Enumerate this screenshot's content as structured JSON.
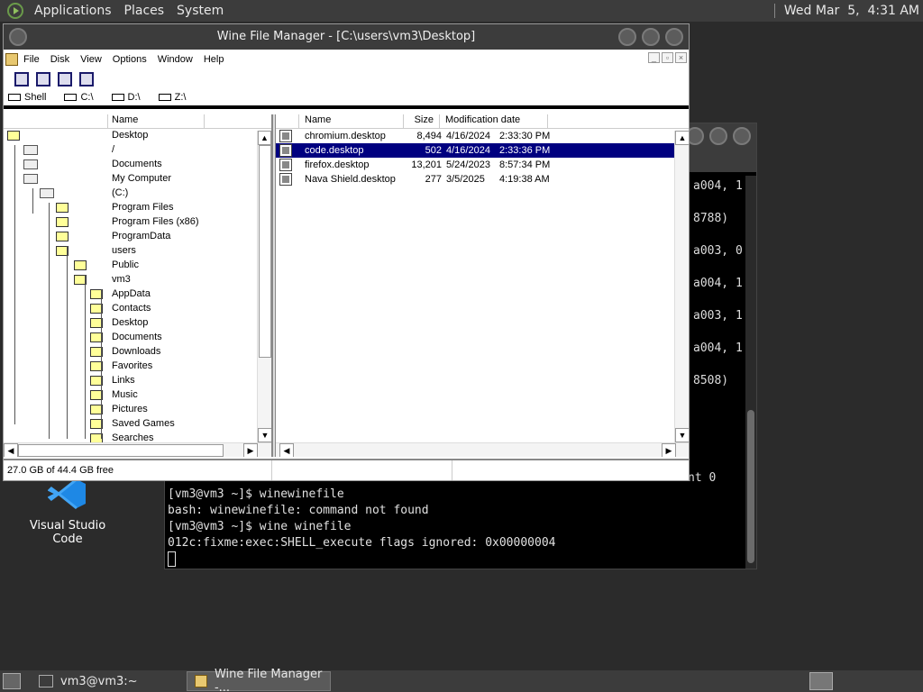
{
  "top_panel": {
    "menus": [
      "Applications",
      "Places",
      "System"
    ],
    "clock": "Wed Mar  5,  4:31 AM"
  },
  "desktop": {
    "vscode_label": "Visual Studio Code"
  },
  "terminal": {
    "right_fragments": [
      "a004, 1",
      "8788)",
      "a003, 0",
      "a004, 1",
      "a003, 1",
      "a004, 1",
      "8508)"
    ],
    "partial_line": "nt 0",
    "lines": [
      "[vm3@vm3 ~]$ winewinefile",
      "bash: winewinefile: command not found",
      "[vm3@vm3 ~]$ wine winefile",
      "012c:fixme:exec:SHELL_execute flags ignored: 0x00000004"
    ]
  },
  "wine": {
    "title": "Wine File Manager - [C:\\users\\vm3\\Desktop]",
    "menu": [
      "File",
      "Disk",
      "View",
      "Options",
      "Window",
      "Help"
    ],
    "drives": [
      "Shell",
      "C:\\",
      "D:\\",
      "Z:\\"
    ],
    "tree_header": "Name",
    "tree": [
      {
        "label": "Desktop",
        "indent": 0,
        "kind": "folder"
      },
      {
        "label": "/",
        "indent": 1,
        "kind": "drive"
      },
      {
        "label": "Documents",
        "indent": 1,
        "kind": "drive"
      },
      {
        "label": "My Computer",
        "indent": 1,
        "kind": "drive"
      },
      {
        "label": "(C:)",
        "indent": 2,
        "kind": "drive"
      },
      {
        "label": "Program Files",
        "indent": 3,
        "kind": "folder"
      },
      {
        "label": "Program Files (x86)",
        "indent": 3,
        "kind": "folder"
      },
      {
        "label": "ProgramData",
        "indent": 3,
        "kind": "folder"
      },
      {
        "label": "users",
        "indent": 3,
        "kind": "folder"
      },
      {
        "label": "Public",
        "indent": 4,
        "kind": "folder"
      },
      {
        "label": "vm3",
        "indent": 4,
        "kind": "folder"
      },
      {
        "label": "AppData",
        "indent": 5,
        "kind": "folder"
      },
      {
        "label": "Contacts",
        "indent": 5,
        "kind": "folder"
      },
      {
        "label": "Desktop",
        "indent": 5,
        "kind": "folder"
      },
      {
        "label": "Documents",
        "indent": 5,
        "kind": "folder"
      },
      {
        "label": "Downloads",
        "indent": 5,
        "kind": "folder"
      },
      {
        "label": "Favorites",
        "indent": 5,
        "kind": "folder"
      },
      {
        "label": "Links",
        "indent": 5,
        "kind": "folder"
      },
      {
        "label": "Music",
        "indent": 5,
        "kind": "folder"
      },
      {
        "label": "Pictures",
        "indent": 5,
        "kind": "folder"
      },
      {
        "label": "Saved Games",
        "indent": 5,
        "kind": "folder"
      },
      {
        "label": "Searches",
        "indent": 5,
        "kind": "folder"
      }
    ],
    "file_headers": {
      "name": "Name",
      "size": "Size",
      "modified": "Modification date"
    },
    "files": [
      {
        "name": "chromium.desktop",
        "size": "8,494",
        "date": "4/16/2024",
        "time": "2:33:30 PM",
        "selected": false
      },
      {
        "name": "code.desktop",
        "size": "502",
        "date": "4/16/2024",
        "time": "2:33:36 PM",
        "selected": true
      },
      {
        "name": "firefox.desktop",
        "size": "13,201",
        "date": "5/24/2023",
        "time": "8:57:34 PM",
        "selected": false
      },
      {
        "name": "Nava Shield.desktop",
        "size": "277",
        "date": "3/5/2025",
        "time": "4:19:38 AM",
        "selected": false
      }
    ],
    "status": "27.0 GB of 44.4 GB free"
  },
  "taskbar": {
    "tasks": [
      {
        "label": "vm3@vm3:~",
        "active": false
      },
      {
        "label": "Wine File Manager -...",
        "active": true
      }
    ]
  }
}
